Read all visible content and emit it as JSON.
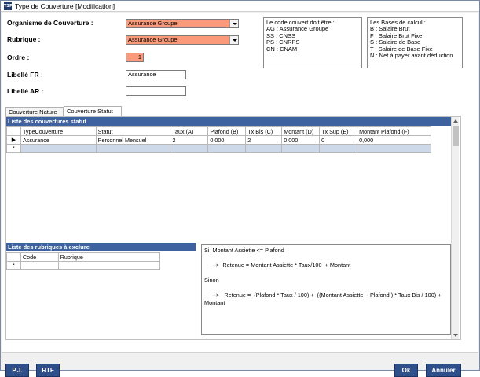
{
  "window": {
    "title": "Type de Couverture [Modification]",
    "app_icon": "TSP"
  },
  "form": {
    "organisme_label": "Organisme de Couverture :",
    "organisme_value": "Assurance Groupe",
    "rubrique_label": "Rubrique :",
    "rubrique_value": "Assurance Groupe",
    "ordre_label": "Ordre :",
    "ordre_value": "1",
    "libelle_fr_label": "Libellé FR :",
    "libelle_fr_value": "Assurance",
    "libelle_ar_label": "Libellé AR :",
    "libelle_ar_value": ""
  },
  "code_info": [
    "Le code couvert doit être :",
    "AG : Assurance Groupe",
    "SS : CNSS",
    "PS : CNRPS",
    "CN : CNAM"
  ],
  "bases_info": [
    "Les Bases de calcul :",
    "B : Salaire Brut",
    "F : Salaire Brut Fixe",
    "S : Salaire de Base",
    "T : Salaire de Base Fixe",
    "N : Net à payer avant déduction"
  ],
  "tabs": [
    "Couverture Nature",
    "Couverture Statut"
  ],
  "statut_panel": {
    "title": "Liste des couvertures statut",
    "columns": [
      "TypeCouverture",
      "Statut",
      "Taux (A)",
      "Plafond (B)",
      "Tx Bis (C)",
      "Montant (D)",
      "Tx Sup (E)",
      "Montant Plafond (F)"
    ],
    "rows": [
      [
        "Assurance",
        "Personnel Mensuel",
        "2",
        "0,000",
        "2",
        "0,000",
        "0",
        "0,000"
      ]
    ],
    "new_row_marker": "*",
    "current_row_marker": "▶"
  },
  "exclure_panel": {
    "title": "Liste des rubriques à exclure",
    "columns": [
      "Code",
      "Rubrique"
    ],
    "new_row_marker": "*"
  },
  "formula": {
    "lines": [
      "Si  Montant Assiette <= Plafond",
      "     -->  Retenue = Montant Assiette * Taux/100  + Montant",
      "Sinon",
      "     -->   Retenue =  (Plafond * Taux / 100) +  ((Montant Assiette  - Plafond ) * Taux Bis / 100) + Montant"
    ]
  },
  "buttons": {
    "pj": "P.J.",
    "rtf": "RTF",
    "ok": "Ok",
    "annuler": "Annuler"
  },
  "colors": {
    "required_field": "#fa9a7a",
    "panel_header": "#3e62a0",
    "button": "#2f4f8a",
    "new_row": "#cdd9e8"
  }
}
